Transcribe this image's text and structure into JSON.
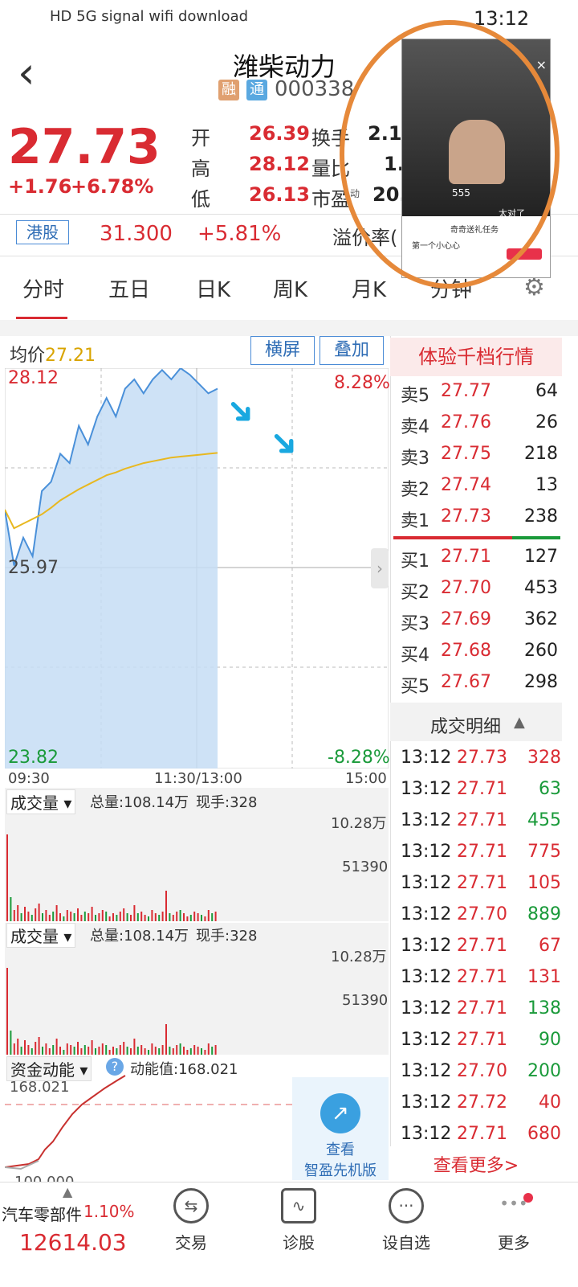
{
  "status": {
    "left_icons": "HD 5G signal wifi download",
    "time": "13:12"
  },
  "header": {
    "back_icon": "‹",
    "name": "潍柴动力",
    "badge1": "融",
    "badge2": "通",
    "code": "000338"
  },
  "quote": {
    "price": "27.73",
    "change": "+1.76",
    "change_pct": "+6.78%",
    "open_label": "开",
    "open": "26.39",
    "turnover_label": "换手",
    "turnover": "2.1",
    "high_label": "高",
    "high": "28.12",
    "vol_ratio_label": "量比",
    "vol_ratio": "1.",
    "low_label": "低",
    "low": "26.13",
    "pe_label": "市盈",
    "pe_sub": "动",
    "pe": "20."
  },
  "hk": {
    "label": "港股",
    "price": "31.300",
    "pct": "+5.81%",
    "premium_label": "溢价率("
  },
  "tabs": [
    "分时",
    "五日",
    "日K",
    "周K",
    "月K",
    "分钟"
  ],
  "chart_toolbar": {
    "avg_label": "均价",
    "avg_value": "27.21",
    "landscape_btn": "横屏",
    "overlay_btn": "叠加"
  },
  "chart_data": {
    "type": "line",
    "y_top": "28.12",
    "y_mid": "25.97",
    "y_bottom": "23.82",
    "pct_top": "8.28%",
    "pct_bottom": "-8.28%",
    "x_labels": [
      "09:30",
      "11:30/13:00",
      "15:00"
    ],
    "ylim": [
      23.82,
      28.12
    ],
    "series": [
      {
        "values": [
          26.6,
          26.0,
          26.3,
          26.1,
          26.8,
          26.9,
          27.2,
          27.1,
          27.5,
          27.3,
          27.6,
          27.8,
          27.6,
          27.9,
          28.0,
          27.85,
          28.0,
          28.1,
          28.0,
          28.12,
          28.05,
          27.95,
          27.85,
          27.9
        ]
      },
      {
        "values": [
          26.6,
          26.4,
          26.45,
          26.5,
          26.55,
          26.62,
          26.7,
          26.76,
          26.82,
          26.87,
          26.92,
          26.97,
          27.0,
          27.04,
          27.07,
          27.1,
          27.12,
          27.14,
          27.16,
          27.17,
          27.18,
          27.19,
          27.2,
          27.21
        ]
      }
    ]
  },
  "volume1": {
    "label": "成交量",
    "total": "总量:108.14万",
    "now": "现手:328",
    "max": "10.28万",
    "mid": "51390"
  },
  "volume2": {
    "label": "成交量",
    "total": "总量:108.14万",
    "now": "现手:328",
    "max": "10.28万",
    "mid": "51390"
  },
  "capital": {
    "label": "资金动能",
    "value_label": "动能值:168.021",
    "top": "168.021",
    "bottom": "100.000",
    "promo1": "查看",
    "promo2": "智盈先机版"
  },
  "orderbook": {
    "title": "体验千档行情",
    "asks": [
      {
        "label": "卖5",
        "price": "27.77",
        "vol": "64"
      },
      {
        "label": "卖4",
        "price": "27.76",
        "vol": "26"
      },
      {
        "label": "卖3",
        "price": "27.75",
        "vol": "218"
      },
      {
        "label": "卖2",
        "price": "27.74",
        "vol": "13"
      },
      {
        "label": "卖1",
        "price": "27.73",
        "vol": "238"
      }
    ],
    "bids": [
      {
        "label": "买1",
        "price": "27.71",
        "vol": "127"
      },
      {
        "label": "买2",
        "price": "27.70",
        "vol": "453"
      },
      {
        "label": "买3",
        "price": "27.69",
        "vol": "362"
      },
      {
        "label": "买4",
        "price": "27.68",
        "vol": "260"
      },
      {
        "label": "买5",
        "price": "27.67",
        "vol": "298"
      }
    ]
  },
  "trades": {
    "title": "成交明细",
    "rows": [
      {
        "t": "13:12",
        "p": "27.73",
        "v": "328",
        "c": "red"
      },
      {
        "t": "13:12",
        "p": "27.71",
        "v": "63",
        "c": "green"
      },
      {
        "t": "13:12",
        "p": "27.71",
        "v": "455",
        "c": "green"
      },
      {
        "t": "13:12",
        "p": "27.71",
        "v": "775",
        "c": "red"
      },
      {
        "t": "13:12",
        "p": "27.71",
        "v": "105",
        "c": "red"
      },
      {
        "t": "13:12",
        "p": "27.70",
        "v": "889",
        "c": "green"
      },
      {
        "t": "13:12",
        "p": "27.71",
        "v": "67",
        "c": "red"
      },
      {
        "t": "13:12",
        "p": "27.71",
        "v": "131",
        "c": "red"
      },
      {
        "t": "13:12",
        "p": "27.71",
        "v": "138",
        "c": "green"
      },
      {
        "t": "13:12",
        "p": "27.71",
        "v": "90",
        "c": "green"
      },
      {
        "t": "13:12",
        "p": "27.70",
        "v": "200",
        "c": "green"
      },
      {
        "t": "13:12",
        "p": "27.72",
        "v": "40",
        "c": "red"
      },
      {
        "t": "13:12",
        "p": "27.71",
        "v": "680",
        "c": "red"
      }
    ],
    "more": "查看更多>"
  },
  "bottom_ticker": {
    "sector": "汽车零部件",
    "pct": "1.10%",
    "value": "12614.03"
  },
  "nav": [
    {
      "label": "交易",
      "icon": "⇆"
    },
    {
      "label": "诊股",
      "icon": "∿"
    },
    {
      "label": "设自选",
      "icon": "···"
    },
    {
      "label": "更多",
      "icon": "•••"
    }
  ],
  "overlay": {
    "line1": "奇奇送礼任务",
    "line2": "第一个小心心",
    "close": "×",
    "count": "555",
    "text": "太对了"
  },
  "colors": {
    "up": "#d92b32",
    "down": "#1a9a3a",
    "accent": "#e6893a"
  }
}
